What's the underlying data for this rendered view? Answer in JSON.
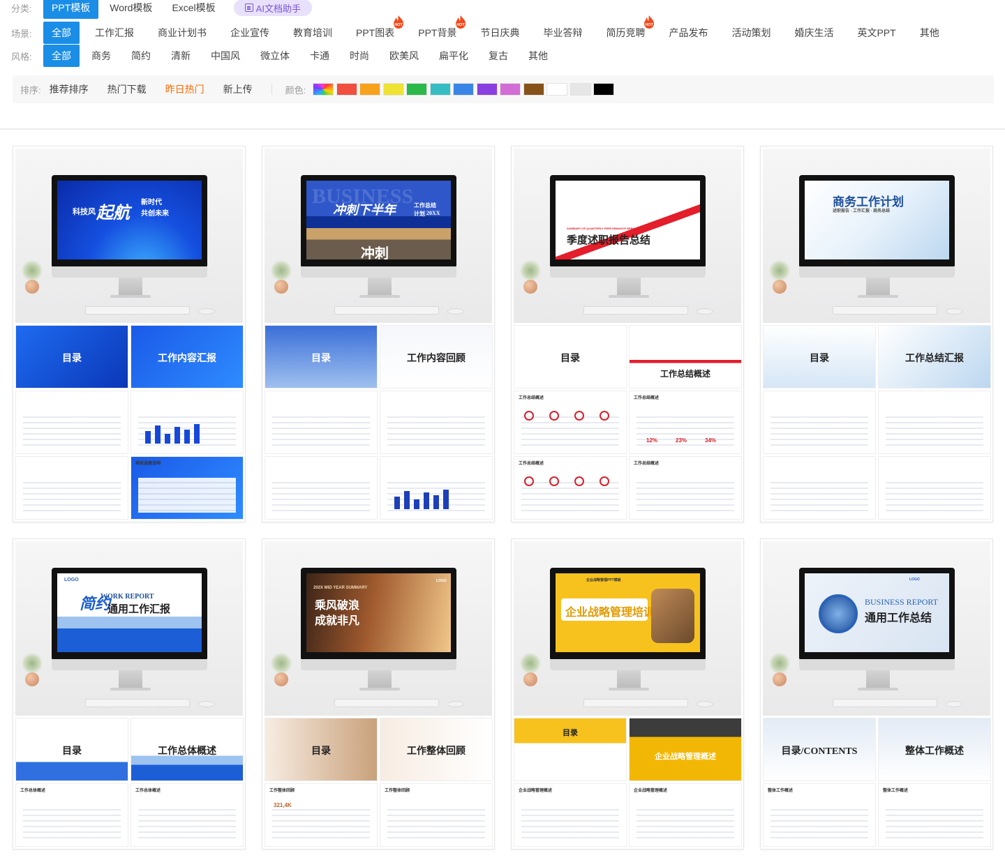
{
  "filters": {
    "category": {
      "label": "分类:",
      "items": [
        "PPT模板",
        "Word模板",
        "Excel模板"
      ],
      "active_index": 0,
      "ai_button": "AI文档助手"
    },
    "scene": {
      "label": "场景:",
      "items": [
        "全部",
        "工作汇报",
        "商业计划书",
        "企业宣传",
        "教育培训",
        "PPT图表",
        "PPT背景",
        "节日庆典",
        "毕业答辩",
        "简历竞聘",
        "产品发布",
        "活动策划",
        "婚庆生活",
        "英文PPT",
        "其他"
      ],
      "hot_items": [
        "PPT图表",
        "PPT背景",
        "简历竞聘"
      ],
      "hot_badge": "HOT",
      "active_index": 0
    },
    "style": {
      "label": "风格:",
      "items": [
        "全部",
        "商务",
        "简约",
        "清新",
        "中国风",
        "微立体",
        "卡通",
        "时尚",
        "欧美风",
        "扁平化",
        "复古",
        "其他"
      ],
      "active_index": 0
    }
  },
  "sort": {
    "label": "排序:",
    "items": [
      "推荐排序",
      "热门下载",
      "昨日热门",
      "新上传"
    ],
    "active_index": 2,
    "color_label": "颜色:",
    "colors": [
      "rainbow",
      "#f04e3e",
      "#f7a21b",
      "#efe232",
      "#2bb94a",
      "#36bdc4",
      "#3a86e6",
      "#8a3fe0",
      "#d26dd6",
      "#86521a",
      "#ffffff",
      "#e6e6e6",
      "#000000"
    ]
  },
  "templates": [
    {
      "screen_lines": [
        "科技风",
        "起航",
        "新时代",
        "共创未来"
      ],
      "thumb_titles": [
        "目录",
        "工作内容汇报",
        "",
        "",
        "",
        "项目进度说明"
      ],
      "theme": "#1648d8"
    },
    {
      "screen_lines": [
        "冲刺下半年",
        "工作总结",
        "计划",
        "20XX",
        "BUSINESS",
        "冲刺"
      ],
      "thumb_titles": [
        "目录",
        "工作内容回顾",
        "",
        "",
        "",
        ""
      ],
      "theme": "#1d3fb8"
    },
    {
      "screen_lines": [
        "季度述职报告总结",
        "SUMMARY OF QUARTERLY PERFORMANCE REPORT"
      ],
      "thumb_titles": [
        "目录",
        "工作总结概述",
        "工作总结概述",
        "工作总结概述",
        "工作总结概述",
        "工作总结概述"
      ],
      "percents": [
        "12%",
        "23%",
        "34%"
      ],
      "theme": "#d8202a"
    },
    {
      "screen_lines": [
        "商务工作计划",
        "述职报告 · 工作汇报 · 商务总结"
      ],
      "thumb_titles": [
        "目录",
        "工作总结汇报",
        "",
        "",
        "",
        ""
      ],
      "theme": "#2e7fd6"
    },
    {
      "screen_lines": [
        "WORK REPORT",
        "简约",
        "通用工作汇报",
        "LOGO"
      ],
      "thumb_titles": [
        "目录",
        "工作总体概述",
        "工作总体概述",
        "工作总体概述"
      ],
      "theme": "#1f5fd0"
    },
    {
      "screen_lines": [
        "202X MID YEAR SUMMARY",
        "乘风破浪",
        "成就非凡",
        "LOGO"
      ],
      "thumb_titles": [
        "目录",
        "工作整体回顾",
        "工作整体回顾",
        "工作整体回顾"
      ],
      "stat": "321,4K",
      "theme": "#c0622a"
    },
    {
      "screen_lines": [
        "企业战略管理培训",
        "企业战略管理PPT模板"
      ],
      "thumb_titles": [
        "目录",
        "企业战略管理概述",
        "企业战略管理概述",
        "企业战略管理概述"
      ],
      "theme": "#f2b705"
    },
    {
      "screen_lines": [
        "BUSINESS REPORT",
        "通用工作总结",
        "LOGO"
      ],
      "thumb_titles": [
        "目录/CONTENTS",
        "整体工作概述",
        "整体工作概述",
        "整体工作概述"
      ],
      "theme": "#2a63b8"
    }
  ]
}
